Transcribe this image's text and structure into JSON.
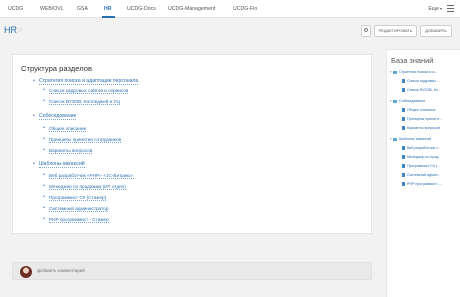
{
  "nav": {
    "tabs": [
      "UCDG",
      "WEB/OVL",
      "GSA",
      "HR",
      "UCDG-Docs",
      "UCDG-Management",
      "UCDG-Fin"
    ],
    "active": "HR",
    "more_label": "Еще"
  },
  "header": {
    "title": "HR",
    "gear_label": "⚙",
    "edit_label": "РЕДАКТИРОВАТЬ",
    "add_label": "ДОБАВИТЬ"
  },
  "content": {
    "heading": "Структура разделов",
    "sections": [
      {
        "label": "Стратегия поиска и адаптации персонала",
        "children": [
          "Список кадровых сайтов и сервисов",
          "Список ВУЗОВ, Колледжей и УЦ"
        ]
      },
      {
        "label": "Собеседование",
        "children": [
          "Общее описание",
          "Принципы принятия сотрудников",
          "Варианты вопросов"
        ]
      },
      {
        "label": "Шаблоны вакансий",
        "children": [
          "Веб разработчик «PHP» +1С-Битрикс»",
          "Менеджер по продажам (ИТ отдел)",
          "Программист C# (Стажер)",
          "Системный администратор",
          "PHP программист - Стажер"
        ]
      }
    ]
  },
  "comment": {
    "placeholder": "Добавить комментарий"
  },
  "knowledge_base": {
    "title": "База знаний",
    "tree": [
      {
        "label": "Стратегия поиска и а...",
        "type": "folder",
        "level": 0,
        "expanded": true
      },
      {
        "label": "Список кадровых ...",
        "type": "doc",
        "level": 1
      },
      {
        "label": "Список ВУЗОВ, Ко...",
        "type": "doc",
        "level": 1
      },
      {
        "label": "Собеседование",
        "type": "folder",
        "level": 0,
        "expanded": true
      },
      {
        "label": "Общее описание",
        "type": "doc",
        "level": 1
      },
      {
        "label": "Принципы приняти...",
        "type": "doc",
        "level": 1
      },
      {
        "label": "Варианты вопросов",
        "type": "doc",
        "level": 1
      },
      {
        "label": "Шаблоны вакансий",
        "type": "folder",
        "level": 0,
        "expanded": true
      },
      {
        "label": "Веб разработчик «...",
        "type": "doc",
        "level": 1
      },
      {
        "label": "Менеджер по прод...",
        "type": "doc",
        "level": 1
      },
      {
        "label": "Программист C# (...",
        "type": "doc",
        "level": 1
      },
      {
        "label": "Системный админ...",
        "type": "doc",
        "level": 1
      },
      {
        "label": "PHP программист -...",
        "type": "doc",
        "level": 1
      }
    ]
  },
  "colors": {
    "accent": "#2a6fb0",
    "folder": "#5aa4d8",
    "doc": "#3d82c2"
  }
}
